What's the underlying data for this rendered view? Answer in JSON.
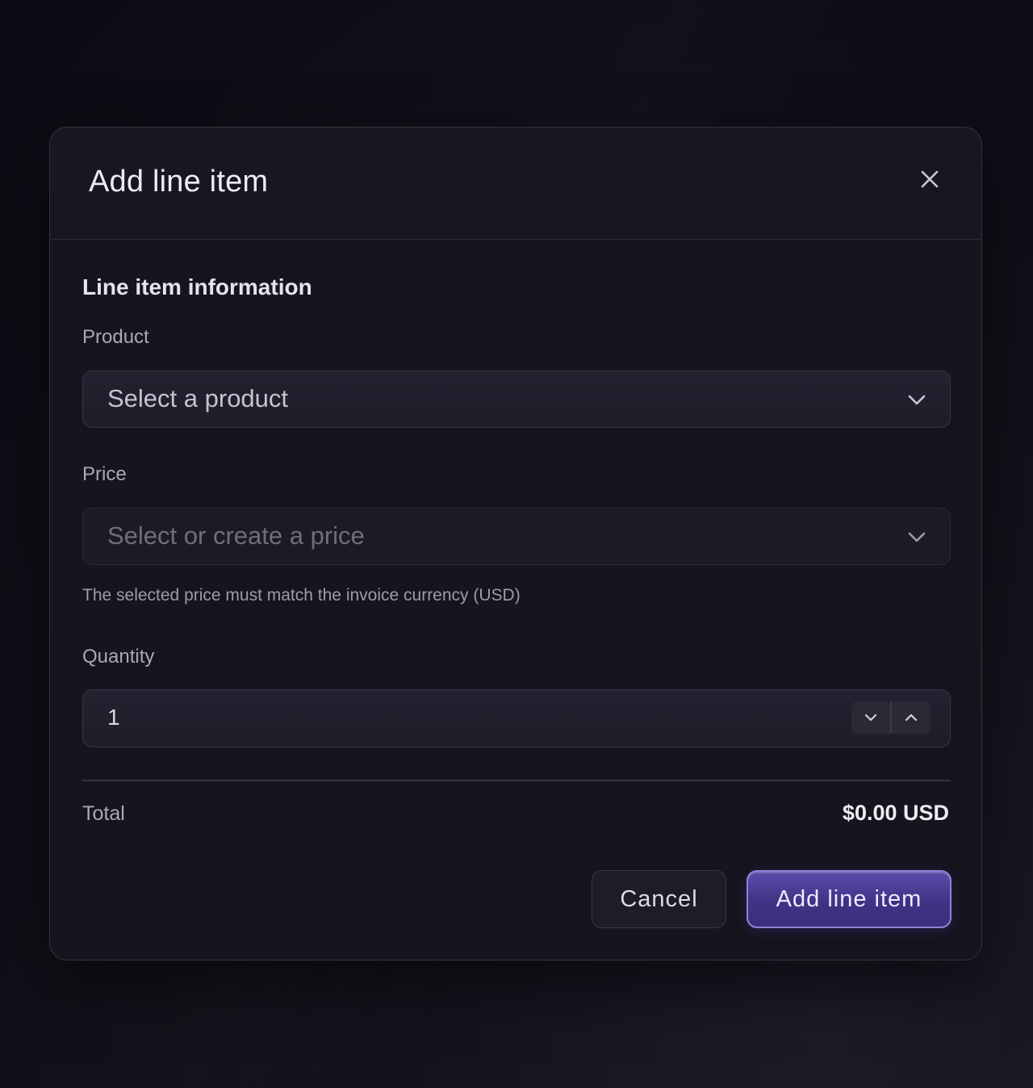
{
  "modal": {
    "title": "Add line item",
    "close_icon": "close-icon"
  },
  "section": {
    "title": "Line item information"
  },
  "product": {
    "label": "Product",
    "placeholder": "Select a product",
    "icon": "chevron-down-icon"
  },
  "price": {
    "label": "Price",
    "placeholder": "Select or create a price",
    "disabled": true,
    "icon": "chevron-down-icon",
    "help_text": "The selected price must match the invoice currency (USD)"
  },
  "quantity": {
    "label": "Quantity",
    "value": "1",
    "decrement_icon": "chevron-down-icon",
    "increment_icon": "chevron-up-icon"
  },
  "total": {
    "label": "Total",
    "value": "$0.00 USD"
  },
  "actions": {
    "cancel_label": "Cancel",
    "submit_label": "Add line item"
  },
  "colors": {
    "accent": "#4a3f99",
    "accent_border": "#8c82d8",
    "background": "#0e0d16",
    "surface": "#15151e"
  }
}
